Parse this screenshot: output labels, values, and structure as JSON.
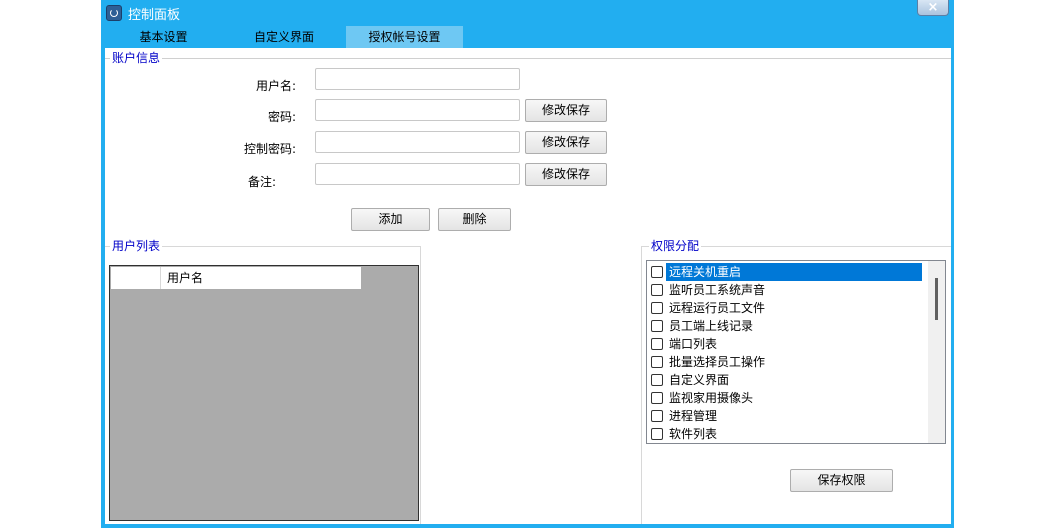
{
  "window": {
    "title": "控制面板",
    "close_label": "×"
  },
  "tabs": [
    {
      "label": "基本设置",
      "active": false
    },
    {
      "label": "自定义界面",
      "active": false
    },
    {
      "label": "授权帐号设置",
      "active": true
    }
  ],
  "account_info": {
    "legend": "账户信息",
    "username_label": "用户名:",
    "username_value": "",
    "password_label": "密码:",
    "password_value": "",
    "control_password_label": "控制密码:",
    "control_password_value": "",
    "note_label": "备注:",
    "note_value": "",
    "save_label": "修改保存",
    "add_label": "添加",
    "delete_label": "删除"
  },
  "user_list": {
    "legend": "用户列表",
    "columns": [
      "",
      "用户名"
    ],
    "rows": []
  },
  "permissions": {
    "legend": "权限分配",
    "items": [
      {
        "label": "远程关机重启",
        "checked": false,
        "selected": true
      },
      {
        "label": "监听员工系统声音",
        "checked": false,
        "selected": false
      },
      {
        "label": "远程运行员工文件",
        "checked": false,
        "selected": false
      },
      {
        "label": "员工端上线记录",
        "checked": false,
        "selected": false
      },
      {
        "label": "端口列表",
        "checked": false,
        "selected": false
      },
      {
        "label": "批量选择员工操作",
        "checked": false,
        "selected": false
      },
      {
        "label": "自定义界面",
        "checked": false,
        "selected": false
      },
      {
        "label": "监视家用摄像头",
        "checked": false,
        "selected": false
      },
      {
        "label": "进程管理",
        "checked": false,
        "selected": false
      },
      {
        "label": "软件列表",
        "checked": false,
        "selected": false
      }
    ],
    "save_label": "保存权限"
  },
  "colors": {
    "window_frame": "#22aef0",
    "active_tab": "#6ec8f3",
    "legend_text": "#0000c8",
    "selection": "#0078d7",
    "listview_background": "#ababab"
  }
}
